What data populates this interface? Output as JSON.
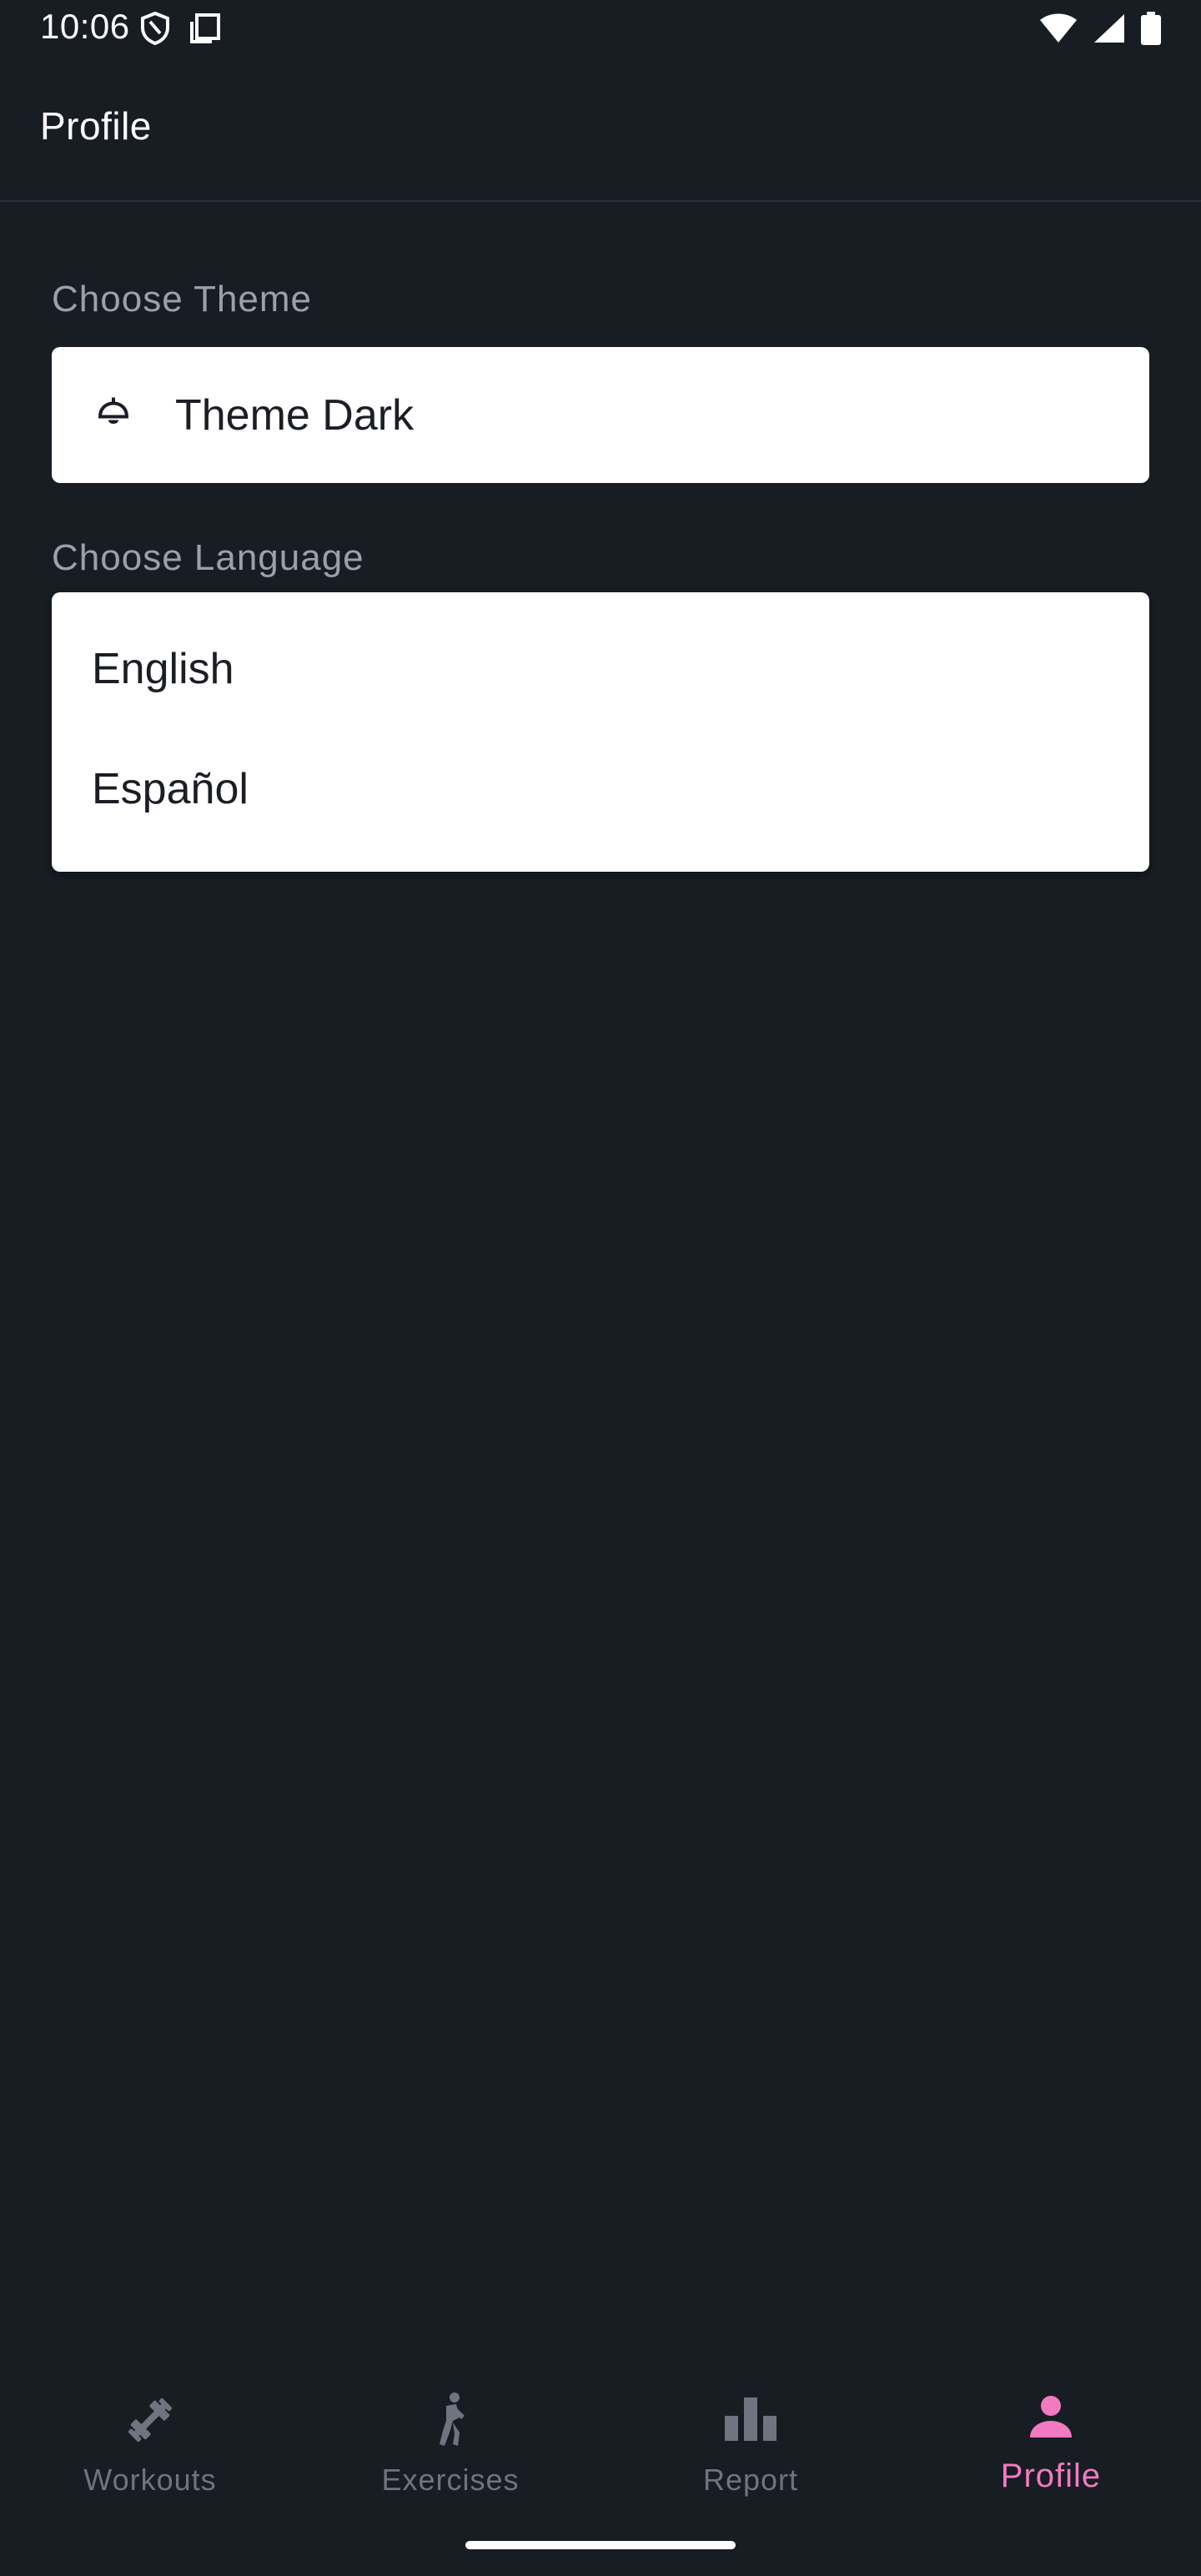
{
  "status_bar": {
    "time": "10:06",
    "left_icons": [
      "shield-icon",
      "clipboard-icon"
    ],
    "right_icons": [
      "wifi-icon",
      "cell-signal-icon",
      "battery-icon"
    ]
  },
  "app_bar": {
    "title": "Profile"
  },
  "theme_section": {
    "label": "Choose Theme",
    "selected_value": "Theme Dark",
    "icon": "lamp-icon"
  },
  "language_section": {
    "label": "Choose Language",
    "options": [
      "English",
      "Español"
    ]
  },
  "bottom_nav": {
    "items": [
      {
        "label": "Workouts",
        "icon": "dumbbell-icon",
        "active": false
      },
      {
        "label": "Exercises",
        "icon": "exercise-figure-icon",
        "active": false
      },
      {
        "label": "Report",
        "icon": "bar-chart-icon",
        "active": false
      },
      {
        "label": "Profile",
        "icon": "person-icon",
        "active": true
      }
    ]
  },
  "colors": {
    "background": "#181c23",
    "accent": "#f27ac0",
    "inactive": "#6e7480",
    "label": "#9aa1ac"
  }
}
